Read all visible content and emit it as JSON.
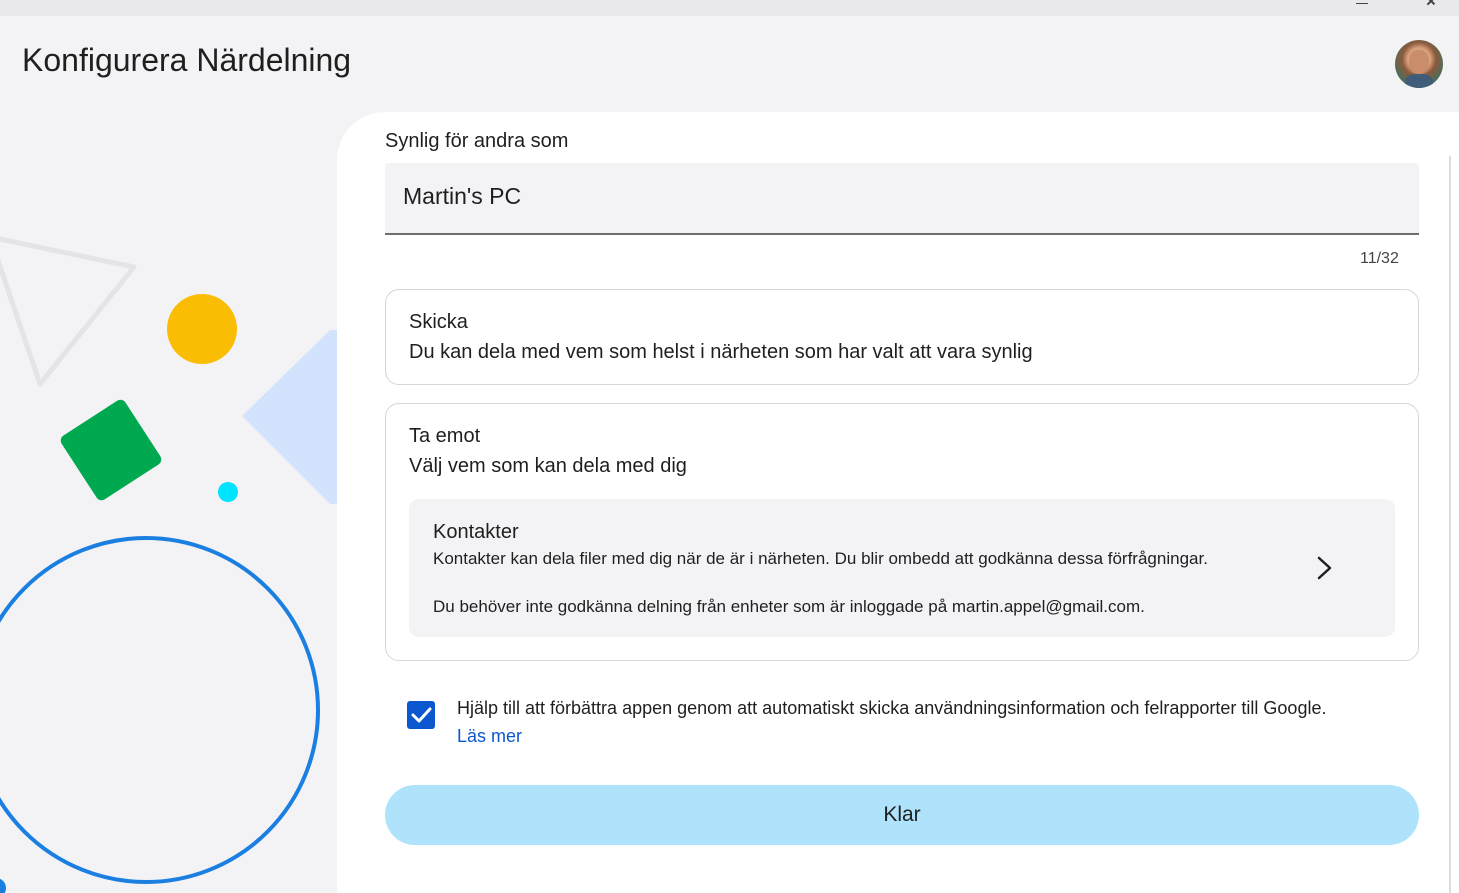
{
  "window": {
    "title": "Konfigurera Närdelning"
  },
  "avatar": {
    "alt": "user-avatar"
  },
  "device_name": {
    "label": "Synlig för andra som",
    "value": "Martin's PC",
    "counter": "11/32"
  },
  "send_card": {
    "title": "Skicka",
    "description": "Du kan dela med vem som helst i närheten som har valt att vara synlig"
  },
  "receive_card": {
    "title": "Ta emot",
    "description": "Välj vem som kan dela med dig",
    "contacts": {
      "title": "Kontakter",
      "line1": "Kontakter kan dela filer med dig när de är i närheten. Du blir ombedd att godkänna dessa förfrågningar.",
      "line2": "Du behöver inte godkänna delning från enheter som är inloggade på martin.appel@gmail.com."
    }
  },
  "usage_stats": {
    "checked": true,
    "text": "Hjälp till att förbättra appen genom att automatiskt skicka användningsinformation och felrapporter till Google.",
    "link": "Läs mer"
  },
  "done_button": {
    "label": "Klar"
  },
  "colors": {
    "accent": "#0b57d0",
    "button_bg": "#aee3fb",
    "yellow": "#fbbc04",
    "green": "#00a94f",
    "light_blue": "#d3e3fd",
    "cyan": "#00e5ff",
    "ring_blue": "#1a7fe0"
  }
}
